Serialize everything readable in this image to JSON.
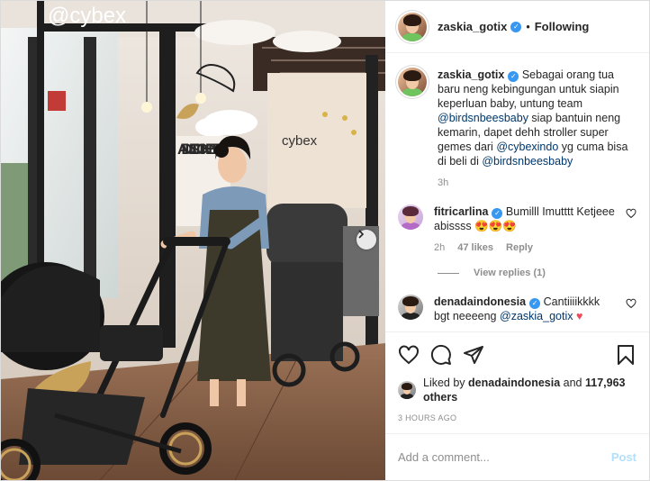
{
  "photo": {
    "brand_sign": "@cybex",
    "wall_sign": "cybex",
    "wall_lettering": "ADULT SUCK HENE REE"
  },
  "header": {
    "username": "zaskia_gotix",
    "separator": "•",
    "follow_status": "Following"
  },
  "caption": {
    "username": "zaskia_gotix",
    "text_1": "Sebagai orang tua baru neng kebingungan untuk siapin keperluan baby, untung team ",
    "mention_1": "@birdsnbeesbaby",
    "text_2": " siap bantuin neng kemarin, dapet dehh stroller super gemes dari ",
    "mention_2": "@cybexindo",
    "text_3": " yg cuma bisa di beli di ",
    "mention_3": "@birdsnbeesbaby",
    "time": "3h"
  },
  "comments": [
    {
      "username": "fitricarlina",
      "text": "Bumilll Imutttt Ketjeee abissss 😍😍😍",
      "time": "2h",
      "likes": "47 likes",
      "reply": "Reply",
      "view_replies": "View replies (1)"
    },
    {
      "username": "denadaindonesia",
      "text": "Cantiiiikkkk bgt neeeeng ",
      "mention": "@zaskia_gotix",
      "emoji": "♥"
    }
  ],
  "likes": {
    "prefix": "Liked by",
    "user": "denadaindonesia",
    "and": "and",
    "others": "117,963 others"
  },
  "timestamp": "3 HOURS AGO",
  "add_comment": {
    "placeholder": "Add a comment...",
    "post_label": "Post"
  },
  "colors": {
    "verified_blue": "#3897f0",
    "mention_blue": "#00376b",
    "post_disabled": "#b2dffc",
    "heart_red": "#ed4956",
    "muted": "#8e8e8e"
  },
  "icons": [
    "heart-icon",
    "comment-icon",
    "share-icon",
    "bookmark-icon",
    "next-arrow-icon",
    "verified-icon"
  ]
}
